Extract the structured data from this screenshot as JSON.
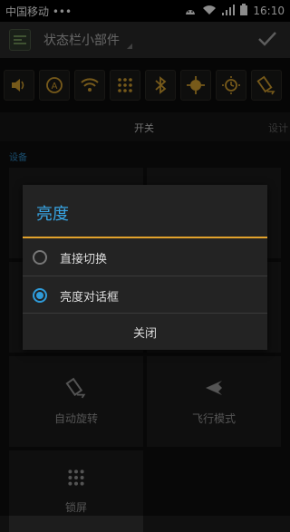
{
  "status_bar": {
    "carrier": "中国移动 •••",
    "time": "16:10"
  },
  "action_bar": {
    "title": "状态栏小部件"
  },
  "strip_icons": [
    "volume-icon",
    "auto-sync-icon",
    "wifi-icon",
    "grid-dots-icon",
    "bluetooth-icon",
    "gps-icon",
    "brightness-icon",
    "rotate-icon"
  ],
  "tabs": {
    "active": "开关",
    "next": "设计"
  },
  "section": {
    "label": "设备"
  },
  "grid": {
    "auto_rotate": "自动旋转",
    "airplane": "飞行模式",
    "lock_screen": "锁屏"
  },
  "dialog": {
    "title": "亮度",
    "options": [
      {
        "label": "直接切换",
        "selected": false
      },
      {
        "label": "亮度对话框",
        "selected": true
      }
    ],
    "close_label": "关闭"
  },
  "colors": {
    "accent_blue": "#38a6e6",
    "divider_orange": "#e2a22c"
  }
}
